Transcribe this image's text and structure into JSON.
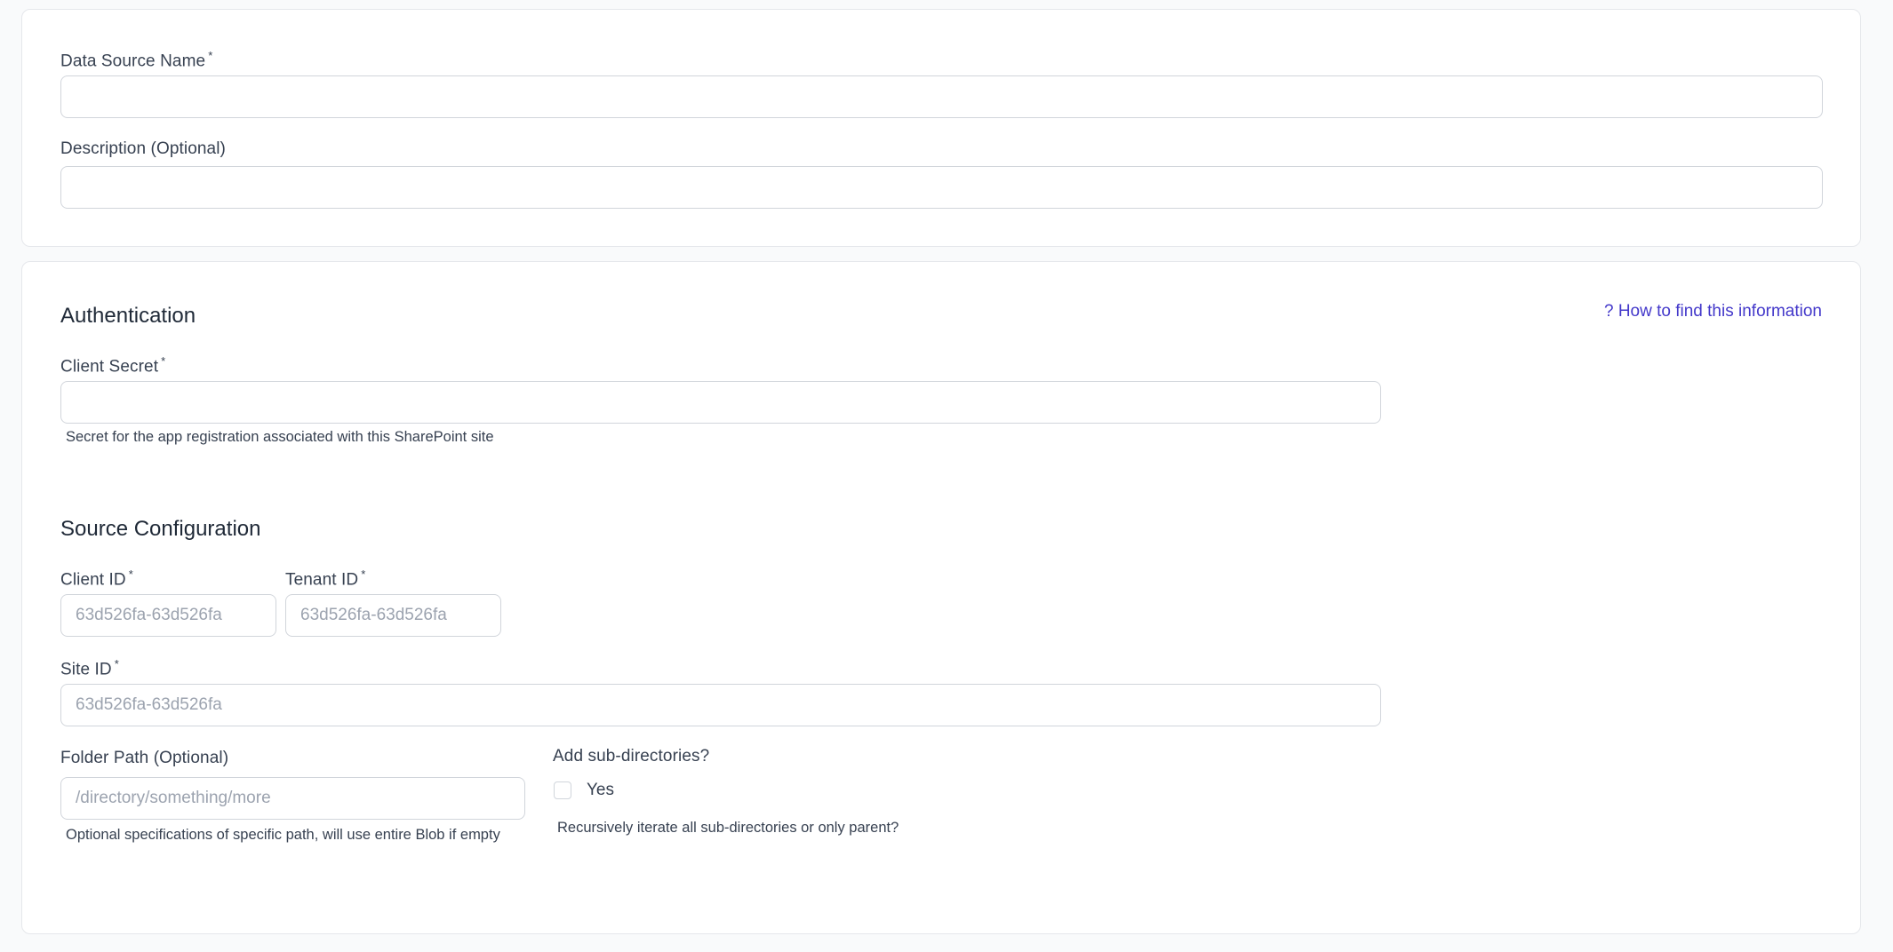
{
  "general": {
    "name_label": "Data Source Name",
    "name_value": "",
    "description_label": "Description (Optional)",
    "description_value": ""
  },
  "required_marker": "*",
  "authentication": {
    "title": "Authentication",
    "help_link": "? How to find this information",
    "client_secret_label": "Client Secret",
    "client_secret_value": "",
    "client_secret_hint": "Secret for the app registration associated with this SharePoint site"
  },
  "source_configuration": {
    "title": "Source Configuration",
    "client_id_label": "Client ID",
    "client_id_placeholder": "63d526fa-63d526fa",
    "tenant_id_label": "Tenant ID",
    "tenant_id_placeholder": "63d526fa-63d526fa",
    "site_id_label": "Site ID",
    "site_id_placeholder": "63d526fa-63d526fa",
    "folder_path_label": "Folder Path (Optional)",
    "folder_path_placeholder": "/directory/something/more",
    "folder_path_hint": "Optional specifications of specific path, will use entire Blob if empty",
    "subdirectories_label": "Add sub-directories?",
    "subdirectories_option": "Yes",
    "subdirectories_checked": false,
    "subdirectories_hint": "Recursively iterate all sub-directories or only parent?"
  },
  "colors": {
    "page_background": "#f9fafb",
    "card_background": "#ffffff",
    "border": "#d1d5db",
    "link": "#4338ca",
    "placeholder": "#9ca3af"
  }
}
